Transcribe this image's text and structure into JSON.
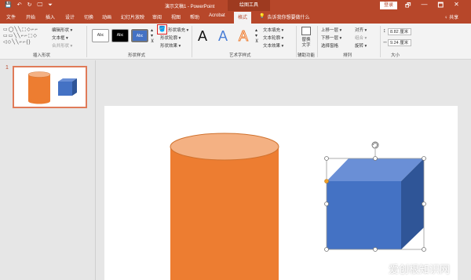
{
  "app": {
    "doc_title": "演示文稿1  -  PowerPoint",
    "contextual_tools": "绘图工具",
    "login": "登录",
    "quick_access": [
      "💾",
      "↶",
      "↻",
      "🖵",
      "⏷"
    ],
    "window_controls": [
      "🗗",
      "—",
      "🗖",
      "✕"
    ]
  },
  "tabs": [
    "文件",
    "开始",
    "插入",
    "设计",
    "切换",
    "动画",
    "幻灯片放映",
    "审阅",
    "视图",
    "帮助",
    "Acrobat",
    "格式"
  ],
  "active_tab": "格式",
  "tell_me": "告诉我你想要做什么",
  "share": "♀ 共享",
  "ribbon": {
    "insert_shapes": {
      "label": "插入形状",
      "shape_gallery": "▭◯╲╲⬚◇⌐⌐\n▭▭╲╲⌐⌐⬚◇\n◁◇╲╲⌐⌐{}",
      "edit_shape": "编辑形状 ▾",
      "text_box": "文本框 ▾",
      "merge_shapes": "合并形状 ▾"
    },
    "shape_styles": {
      "label": "形状样式",
      "presets": [
        "Abc",
        "Abc",
        "Abc"
      ],
      "shape_fill": "形状填充 ▾",
      "shape_outline": "形状轮廓 ▾",
      "shape_effects": "形状效果 ▾"
    },
    "wordart": {
      "label": "艺术字样式",
      "letters": [
        "A",
        "A",
        "A"
      ],
      "text_fill": "文本填充 ▾",
      "text_outline": "文本轮廓 ▾",
      "text_effects": "文本效果 ▾"
    },
    "accessibility": {
      "label": "辅助功能",
      "alt_text": "替换文字"
    },
    "arrange": {
      "label": "排列",
      "bring_forward": "上移一层 ▾",
      "send_backward": "下移一层 ▾",
      "selection_pane": "选择窗格",
      "align": "对齐 ▾",
      "group": "组合 ▾",
      "rotate": "旋转 ▾"
    },
    "size": {
      "label": "大小",
      "height": "8.82 厘米",
      "width": "9.24 厘米"
    }
  },
  "slides": {
    "number": "1"
  },
  "watermark": "爱创根知识网",
  "colors": {
    "accent": "#b7472a",
    "cylinder": "#ed7d31",
    "cylinder_top": "#f4b183",
    "cube_front": "#4472c4",
    "cube_top": "#6a8fd6",
    "cube_side": "#2f5597"
  }
}
